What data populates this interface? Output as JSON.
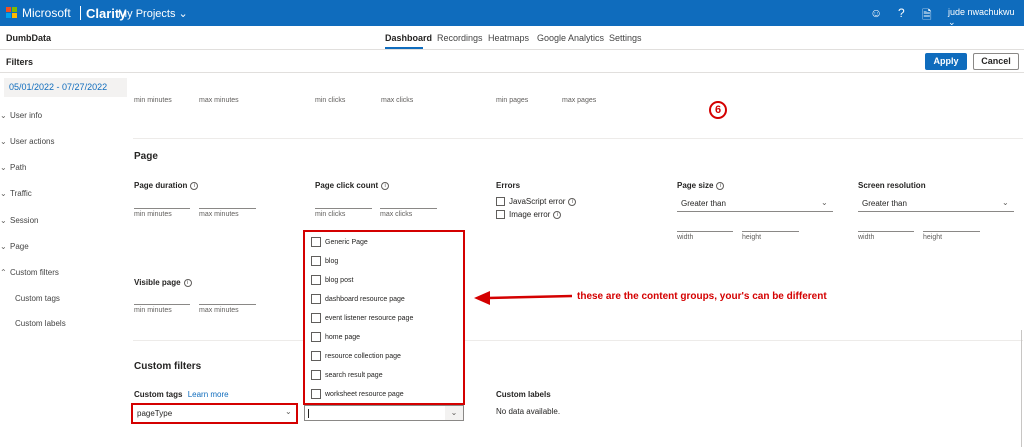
{
  "topbar": {
    "brand_ms": "Microsoft",
    "brand_product": "Clarity",
    "projects": "My Projects",
    "user": "jude nwachukwu",
    "icons": [
      "smiley-icon",
      "help-icon",
      "document-icon",
      "chevron-down-icon"
    ]
  },
  "subnav": {
    "site": "DumbData",
    "tabs": [
      "Dashboard",
      "Recordings",
      "Heatmaps",
      "Google Analytics",
      "Settings"
    ],
    "active_tab": "Dashboard"
  },
  "filterbar": {
    "label": "Filters",
    "apply": "Apply",
    "cancel": "Cancel",
    "daterange": "05/01/2022 - 07/27/2022"
  },
  "sidebar": {
    "items": [
      "User info",
      "User actions",
      "Path",
      "Traffic",
      "Session",
      "Page",
      "Custom filters"
    ],
    "sub_items": [
      "Custom tags",
      "Custom labels"
    ]
  },
  "top_row": {
    "min_minutes": "min minutes",
    "max_minutes": "max minutes",
    "min_clicks": "min clicks",
    "max_clicks": "max clicks",
    "min_pages": "min pages",
    "max_pages": "max pages"
  },
  "badge": "6",
  "page_section": {
    "title": "Page",
    "page_duration": "Page duration",
    "page_click_count": "Page click count",
    "errors": "Errors",
    "js_error": "JavaScript error",
    "image_error": "Image error",
    "page_size": "Page size",
    "screen_resolution": "Screen resolution",
    "greater_than": "Greater than",
    "width": "width",
    "height": "height",
    "visible_page": "Visible page",
    "min_minutes": "min minutes",
    "max_minutes": "max minutes",
    "min_clicks": "min clicks",
    "max_clicks": "max clicks"
  },
  "content_groups": [
    "Generic Page",
    "blog",
    "blog post",
    "dashboard resource page",
    "event listener resource page",
    "home page",
    "resource collection page",
    "search result page",
    "worksheet resource page"
  ],
  "annotation": "these are the content groups, your's can be different",
  "custom_filters": {
    "title": "Custom filters",
    "custom_tags": "Custom tags",
    "learn_more": "Learn more",
    "selected_tag": "pageType",
    "custom_labels": "Custom labels",
    "no_data": "No data available."
  },
  "colors": {
    "brand_blue": "#0f6cbd",
    "highlight_red": "#d40000"
  }
}
